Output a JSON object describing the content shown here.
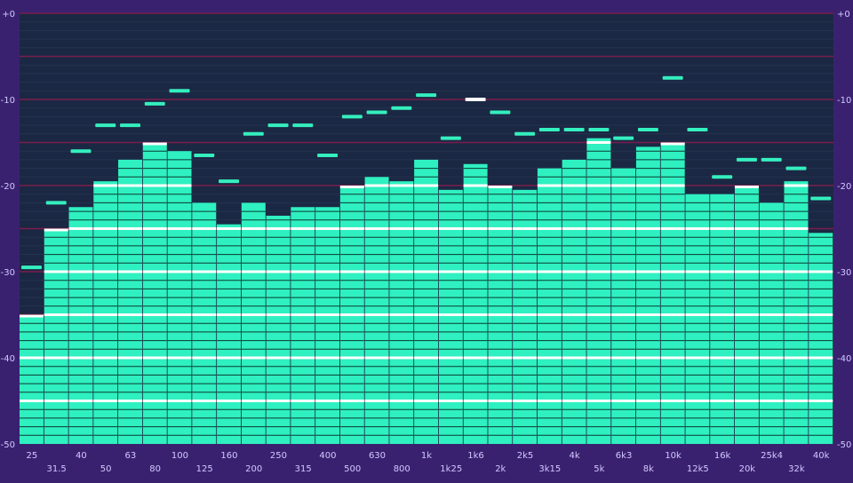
{
  "chart_data": {
    "type": "bar",
    "title": "",
    "xlabel": "",
    "ylabel": "",
    "ylim": [
      -50,
      0
    ],
    "y_ticks": [
      "+0",
      "-10",
      "-20",
      "-30",
      "-40",
      "-50"
    ],
    "y_tick_values": [
      0,
      -10,
      -20,
      -30,
      -40,
      -50
    ],
    "categories": [
      "25",
      "31.5",
      "40",
      "50",
      "63",
      "80",
      "100",
      "125",
      "160",
      "200",
      "250",
      "315",
      "400",
      "500",
      "630",
      "800",
      "1k",
      "1k25",
      "1k6",
      "2k",
      "2k5",
      "3k15",
      "4k",
      "5k",
      "6k3",
      "8k",
      "10k",
      "12k5",
      "16k",
      "20k",
      "25k4",
      "32k",
      "40k"
    ],
    "series": [
      {
        "values": [
          -35.0,
          -25.0,
          -22.5,
          -19.5,
          -17.0,
          -15.0,
          -16.0,
          -22.0,
          -24.5,
          -22.0,
          -23.5,
          -22.5,
          -22.5,
          -20.0,
          -19.0,
          -19.5,
          -17.0,
          -20.5,
          -17.5,
          -20.0,
          -20.5,
          -18.0,
          -17.0,
          -14.5,
          -18.0,
          -15.5,
          -15.0,
          -21.0,
          -21.0,
          -20.0,
          -22.0,
          -19.5,
          -25.5
        ]
      },
      {
        "values": [
          -29.5,
          -22.0,
          -16.0,
          -13.0,
          -13.0,
          -10.5,
          -9.0,
          -16.5,
          -19.5,
          -14.0,
          -13.0,
          -13.0,
          -16.5,
          -12.0,
          -11.5,
          -11.0,
          -9.5,
          -14.5,
          -10.0,
          -11.5,
          -14.0,
          -13.5,
          -13.5,
          -13.5,
          -14.5,
          -13.5,
          -7.5,
          -13.5,
          -19.0,
          -17.0,
          -17.0,
          -18.0,
          -21.5
        ]
      }
    ],
    "colors": {
      "frame": "#3a2170",
      "plot_background": "#1b2844",
      "bar": "#2ff0c0",
      "segment_line": "#0b3a33",
      "marker_line": "#ffffff",
      "peak": "#34efbe",
      "reference_line": "#7a1d4a",
      "label": "#d2c9ff"
    }
  }
}
